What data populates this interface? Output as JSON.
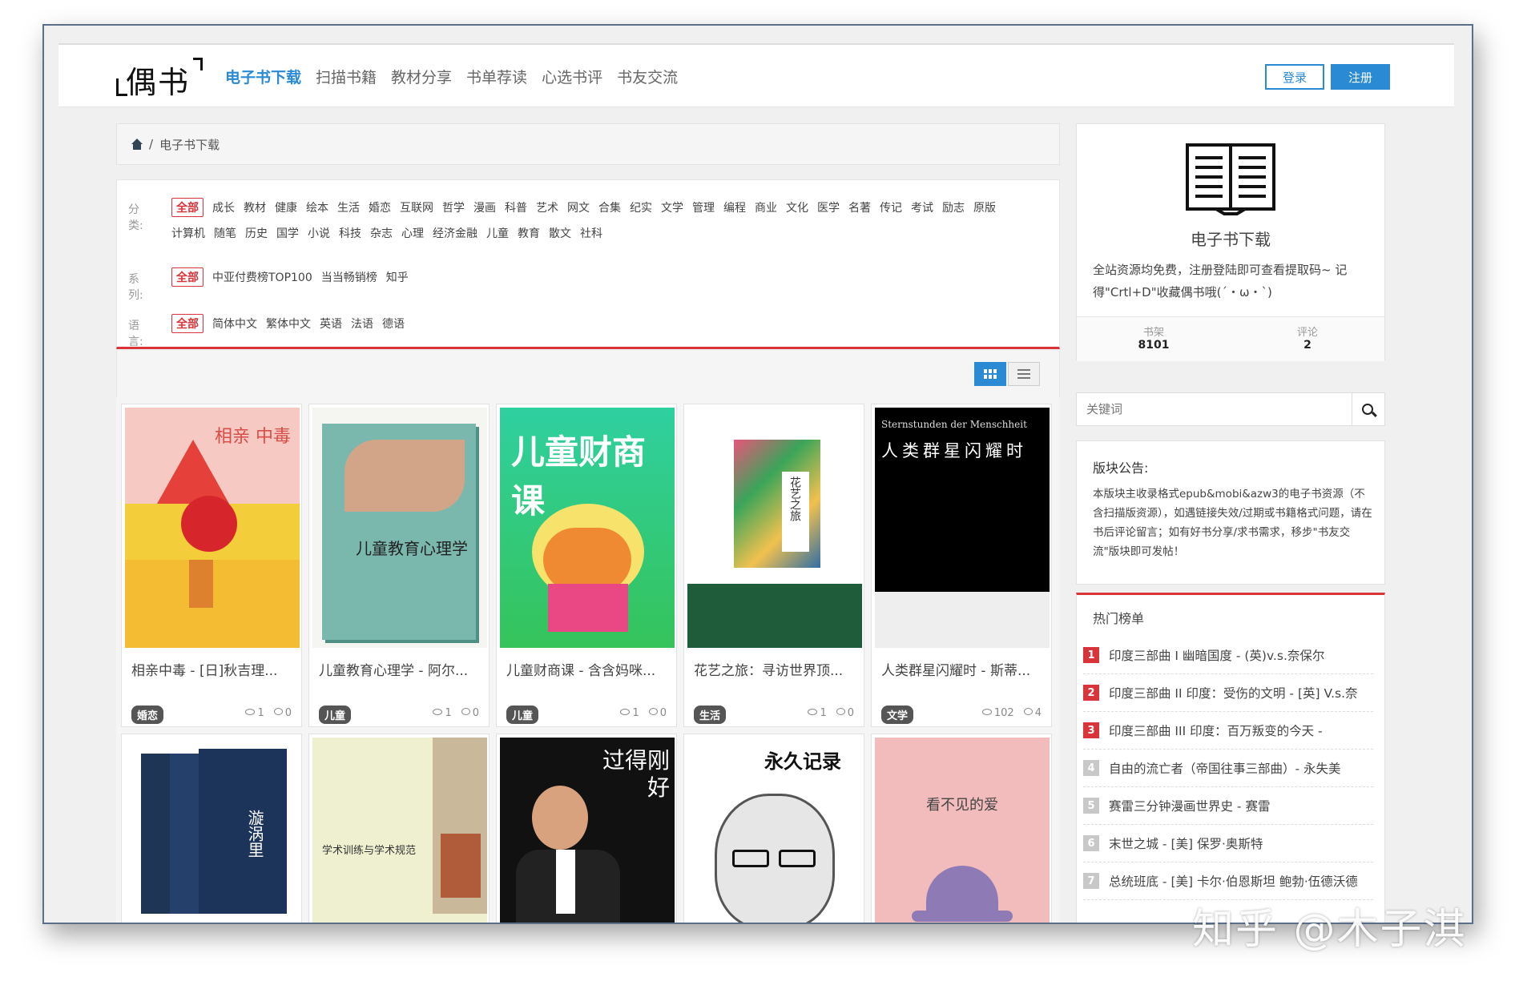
{
  "header": {
    "logo": "偶书",
    "nav": [
      "电子书下载",
      "扫描书籍",
      "教材分享",
      "书单荐读",
      "心选书评",
      "书友交流"
    ],
    "login": "登录",
    "register": "注册"
  },
  "breadcrumb": {
    "current": "电子书下载",
    "sep": "/"
  },
  "filters": {
    "category_label": "分类:",
    "category_items": [
      "全部",
      "成长",
      "教材",
      "健康",
      "绘本",
      "生活",
      "婚恋",
      "互联网",
      "哲学",
      "漫画",
      "科普",
      "艺术",
      "网文",
      "合集",
      "纪实",
      "文学",
      "管理",
      "编程",
      "商业",
      "文化",
      "医学",
      "名著",
      "传记",
      "考试",
      "励志",
      "原版",
      "计算机",
      "随笔",
      "历史",
      "国学",
      "小说",
      "科技",
      "杂志",
      "心理",
      "经济金融",
      "儿童",
      "教育",
      "散文",
      "社科"
    ],
    "series_label": "系列:",
    "series_items": [
      "全部",
      "中亚付费榜TOP100",
      "当当畅销榜",
      "知乎"
    ],
    "language_label": "语言:",
    "language_items": [
      "全部",
      "简体中文",
      "繁体中文",
      "英语",
      "法语",
      "德语"
    ]
  },
  "books": [
    {
      "title": "相亲中毒 - [日]秋吉理...",
      "badge": "婚恋",
      "views": "1",
      "comments": "0",
      "cover_text": "相亲 中毒"
    },
    {
      "title": "儿童教育心理学 - 阿尔...",
      "badge": "儿童",
      "views": "1",
      "comments": "0",
      "cover_text": "儿童教育心理学"
    },
    {
      "title": "儿童财商课 - 含含妈咪...",
      "badge": "儿童",
      "views": "1",
      "comments": "0",
      "cover_text": "儿童财商课"
    },
    {
      "title": "花艺之旅：寻访世界顶...",
      "badge": "生活",
      "views": "1",
      "comments": "0",
      "cover_text": "花艺之旅"
    },
    {
      "title": "人类群星闪耀时 - 斯蒂...",
      "badge": "文学",
      "views": "102",
      "comments": "4",
      "cover_text": "人类群星闪耀时",
      "cover_sub": "Sternstunden der Menschheit"
    },
    {
      "title": "",
      "badge": "",
      "views": "",
      "comments": "",
      "cover_text": "漩涡里"
    },
    {
      "title": "",
      "badge": "",
      "views": "",
      "comments": "",
      "cover_text": "学术训练与学术规范"
    },
    {
      "title": "",
      "badge": "",
      "views": "",
      "comments": "",
      "cover_text": "过得刚好"
    },
    {
      "title": "",
      "badge": "",
      "views": "",
      "comments": "",
      "cover_text": "永久记录"
    },
    {
      "title": "",
      "badge": "",
      "views": "",
      "comments": "",
      "cover_text": "看不见的爱"
    }
  ],
  "sidebar": {
    "title": "电子书下载",
    "desc": "全站资源均免费，注册登陆即可查看提取码~ 记得\"Crtl+D\"收藏偶书哦(ˊ・ω・ˋ)",
    "shelf_label": "书架",
    "shelf_value": "8101",
    "comment_label": "评论",
    "comment_value": "2",
    "search_placeholder": "关键词",
    "notice_title": "版块公告:",
    "notice_body": "本版块主收录格式epub&mobi&azw3的电子书资源（不含扫描版资源），如遇链接失效/过期或书籍格式问题，请在书后评论留言；如有好书分享/求书需求，移步\"书友交流\"版块即可发帖！",
    "hot_title": "热门榜单",
    "hot_list": [
      {
        "rank": "1",
        "text": "印度三部曲 I 幽暗国度 - (英)v.s.奈保尔"
      },
      {
        "rank": "2",
        "text": "印度三部曲 II 印度：受伤的文明 - [英] V.s.奈"
      },
      {
        "rank": "3",
        "text": "印度三部曲 III 印度：百万叛变的今天 -"
      },
      {
        "rank": "4",
        "text": "自由的流亡者（帝国往事三部曲）- 永失美"
      },
      {
        "rank": "5",
        "text": "赛雷三分钟漫画世界史 - 赛雷"
      },
      {
        "rank": "6",
        "text": "末世之城 - [美] 保罗·奥斯特"
      },
      {
        "rank": "7",
        "text": "总统班底 - [美] 卡尔·伯恩斯坦 鲍勃·伍德沃德"
      }
    ]
  },
  "watermark": "知乎 @木子淇",
  "colors": {
    "accent": "#2a8ad4",
    "red": "#d9343a"
  }
}
